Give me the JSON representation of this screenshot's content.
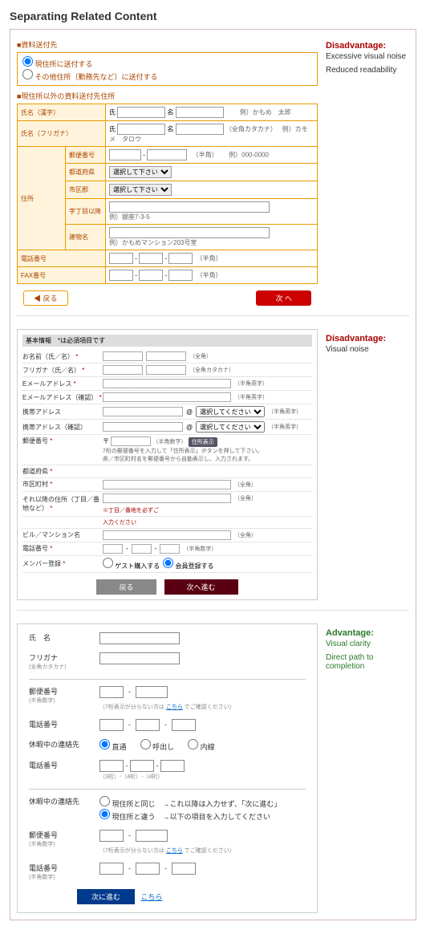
{
  "page": {
    "title": "Separating Related Content"
  },
  "notes": {
    "ex1": {
      "heading": "Disadvantage:",
      "line1": "Excessive visual noise",
      "line2": "Reduced readability"
    },
    "ex2": {
      "heading": "Disadvantage:",
      "line1": "Visual noise"
    },
    "ex3": {
      "heading": "Advantage:",
      "line1": "Visual clarity",
      "line2": "Direct path to completion"
    }
  },
  "ex1": {
    "sec_send_to": "■資料送付先",
    "radio1": "現住所に送付する",
    "radio2": "その他住所（勤務先など）に送付する",
    "sec_other_addr": "■現住所以外の資料送付先住所",
    "name_kanji": "氏名（漢字）",
    "name_furigana": "氏名（フリガナ）",
    "surname": "氏",
    "given": "名",
    "ex_kanji": "例）かもめ　太郎",
    "ex_kana": "例）カモメ　タロウ",
    "kana_note": "（全角カタカナ）",
    "address": "住所",
    "postal": "郵便番号",
    "postal_note": "（半角）",
    "postal_ex": "例）000-0000",
    "pref": "都道府県",
    "sel_placeholder": "選択して下さい",
    "city": "市区郡",
    "town": "字丁目以降",
    "town_ex": "例）銀座7-3-5",
    "bldg": "建物名",
    "bldg_ex": "例）かもめマンション203号室",
    "tel": "電話番号",
    "tel_note": "（半角）",
    "fax": "FAX番号",
    "fax_note": "（半角）",
    "back": "◀ 戻る",
    "next": "次 へ"
  },
  "ex2": {
    "header": "基本情報　*は必須項目です",
    "name": "お名前（氏／名）",
    "furigana": "フリガナ（氏／名）",
    "email": "Eメールアドレス",
    "email_confirm": "Eメールアドレス（確認）",
    "mobile_addr": "携帯アドレス",
    "mobile_addr_confirm": "携帯アドレス（確認）",
    "sel_placeholder": "選択してください",
    "postal": "郵便番号",
    "postal_prefix": "〒",
    "postal_btn": "住所表示",
    "postal_note1": "7桁の郵便番号を入力して「住所表示」ボタンを押して下さい。",
    "postal_note2": "県／市区町村名を郵便番号から自動表示し、入力されます。",
    "pref": "都道府県",
    "city": "市区町村",
    "town": "それ以降の住所（丁目／番地など）",
    "bldg": "ビル／マンション名",
    "tel": "電話番号",
    "member": "メンバー登録",
    "member_guest": "ゲスト購入する",
    "member_reg": "会員登録する",
    "full": "（全角）",
    "fullkana": "（全角カタカナ）",
    "half_en": "（半角英字）",
    "half_num": "（半角数字）",
    "req_note_town": "※丁目／番地を必ずご",
    "req_note_enter": "入力ください",
    "back": "戻る",
    "next": "次へ進む"
  },
  "ex3": {
    "name": "氏　名",
    "furigana": "フリガナ",
    "furigana_sub": "(全角カタカナ)",
    "postal": "郵便番号",
    "postal_sub": "(半角数字)",
    "postal_note_pre": "（7桁表示が分らない方は ",
    "postal_link": "こちら",
    "postal_note_post": " でご確認ください）",
    "tel": "電話番号",
    "vacation_contact": "休暇中の連絡先",
    "vc_direct": "直通",
    "vc_page": "呼出し",
    "vc_ext": "内線",
    "tel2": "電話番号",
    "tel2_note": "（3桁）-（4桁）-（4桁）",
    "vacation_dest": "休暇中の連絡先",
    "vd_opt1": "現住所と同じ　→これ以降は入力せず、「次に進む」",
    "vd_opt2": "現住所と違う　→以下の項目を入力してください",
    "next": "次に進む",
    "link": "こちら"
  }
}
